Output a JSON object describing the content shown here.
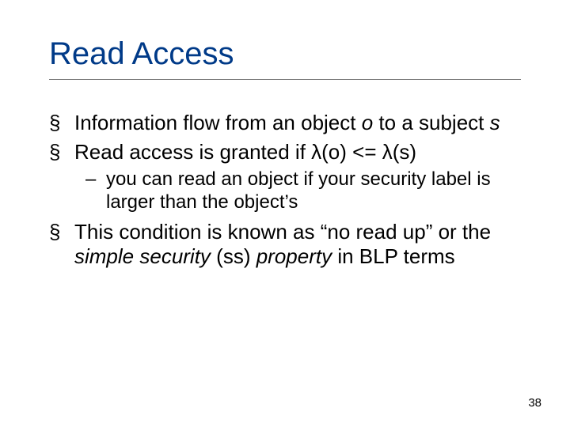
{
  "slide": {
    "title": "Read Access",
    "page_number": "38",
    "bullets": [
      {
        "segments": [
          {
            "t": "Information flow from an object "
          },
          {
            "t": "o",
            "i": true
          },
          {
            "t": " to a subject "
          },
          {
            "t": "s",
            "i": true
          }
        ]
      },
      {
        "segments": [
          {
            "t": "Read access is granted if λ(o) <= λ(s)"
          }
        ],
        "sub": [
          {
            "segments": [
              {
                "t": "you can read an object if your security label is larger than the object’s"
              }
            ]
          }
        ]
      },
      {
        "segments": [
          {
            "t": "This condition is known as “no read up” or the "
          },
          {
            "t": "simple security",
            "i": true
          },
          {
            "t": " (ss) "
          },
          {
            "t": "property",
            "i": true
          },
          {
            "t": " in BLP terms"
          }
        ]
      }
    ]
  }
}
